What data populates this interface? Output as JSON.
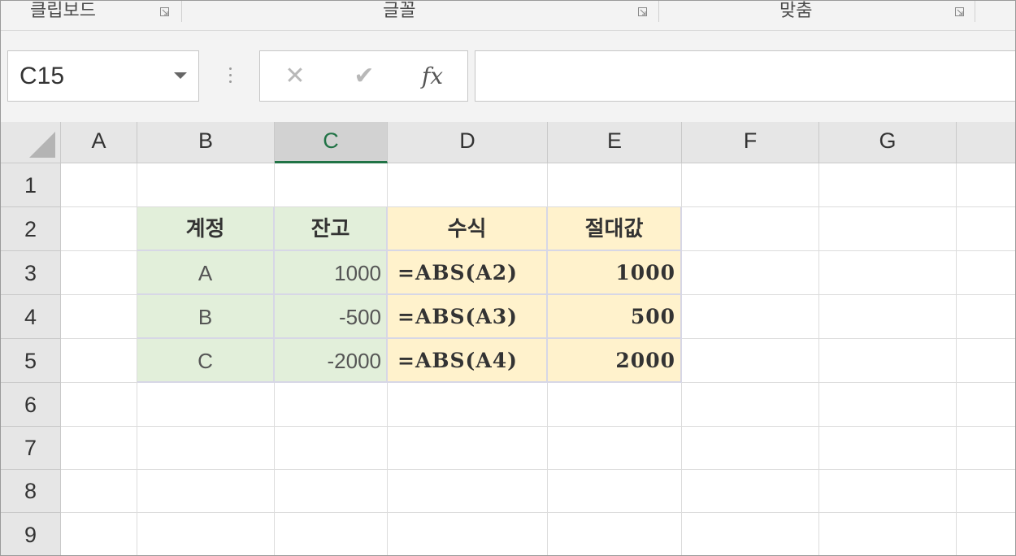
{
  "ribbon": {
    "groups": [
      "클립보드",
      "글꼴",
      "맞춤"
    ]
  },
  "formula_bar": {
    "name_box": "C15",
    "cancel_glyph": "✕",
    "enter_glyph": "✔",
    "fx_label": "fx",
    "formula": ""
  },
  "sheet": {
    "columns": [
      "A",
      "B",
      "C",
      "D",
      "E",
      "F",
      "G"
    ],
    "selected_column": "C",
    "rows": [
      "1",
      "2",
      "3",
      "4",
      "5",
      "6",
      "7",
      "8",
      "9"
    ],
    "table": {
      "header": [
        "계정",
        "잔고",
        "수식",
        "절대값"
      ],
      "rows": [
        [
          "A",
          "1000",
          "=ABS(A2)",
          "1000"
        ],
        [
          "B",
          "-500",
          "=ABS(A3)",
          "500"
        ],
        [
          "C",
          "-2000",
          "=ABS(A4)",
          "2000"
        ]
      ]
    }
  },
  "colors": {
    "accent": "#217346",
    "label_fill": "#e2efda",
    "formula_fill": "#fff2cc"
  }
}
